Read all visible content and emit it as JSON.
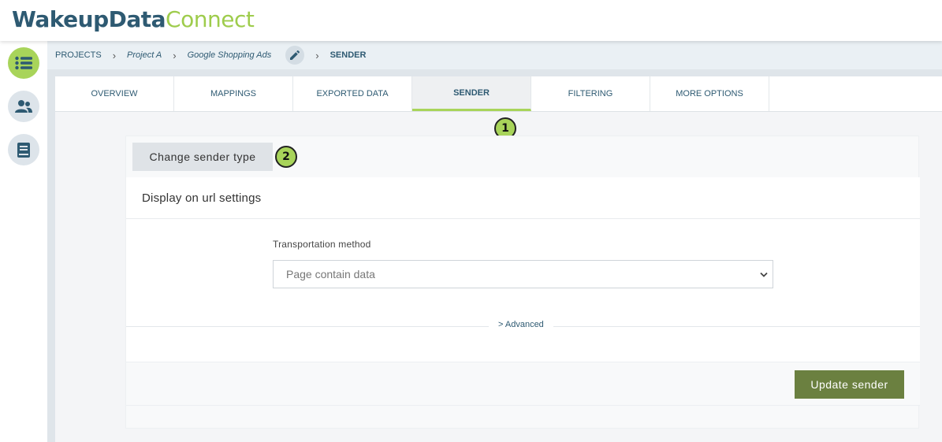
{
  "header": {
    "logo_primary": "WakeupData",
    "logo_secondary": "Connect"
  },
  "sidebar": {
    "items": [
      {
        "icon": "list-icon",
        "active": true
      },
      {
        "icon": "users-icon",
        "active": false
      },
      {
        "icon": "book-icon",
        "active": false
      }
    ]
  },
  "breadcrumb": {
    "items": [
      "PROJECTS",
      "Project A",
      "Google Shopping Ads"
    ],
    "current": "SENDER"
  },
  "tabs": [
    "OVERVIEW",
    "MAPPINGS",
    "EXPORTED DATA",
    "SENDER",
    "FILTERING",
    "MORE OPTIONS"
  ],
  "active_tab": "SENDER",
  "badges": {
    "one": "1",
    "two": "2"
  },
  "sender": {
    "change_label": "Change sender type",
    "settings_title": "Display on url settings",
    "transport_label": "Transportation method",
    "transport_value": "Page contain data",
    "advanced_label": "> Advanced",
    "update_label": "Update sender"
  },
  "colors": {
    "accent_green": "#a8d45a",
    "brand_blue": "#2e5a72",
    "button_olive": "#6b8040"
  }
}
